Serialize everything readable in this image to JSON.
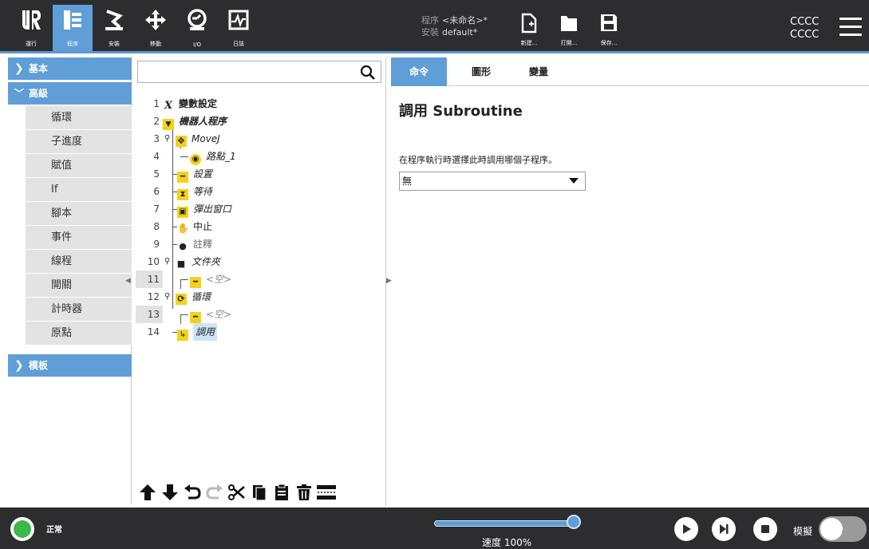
{
  "topnav": {
    "items": [
      {
        "label": "運行",
        "icon": "ur-logo-icon"
      },
      {
        "label": "程序",
        "icon": "program-tree-icon",
        "active": true
      },
      {
        "label": "安裝",
        "icon": "install-icon"
      },
      {
        "label": "移動",
        "icon": "move-arrows-icon"
      },
      {
        "label": "I/O",
        "icon": "io-icon"
      },
      {
        "label": "日誌",
        "icon": "log-icon"
      }
    ],
    "program_key": "程序",
    "program_value": "<未命名>*",
    "install_key": "安裝",
    "install_value": "default*",
    "file_new": "新建...",
    "file_open": "打開...",
    "file_save": "保存...",
    "user_line1": "CCCC",
    "user_line2": "CCCC"
  },
  "left_panel": {
    "cat_basic": "基本",
    "cat_advanced": "高級",
    "advanced_items": [
      "循環",
      "子進度",
      "賦值",
      "If",
      "腳本",
      "事件",
      "線程",
      "開關",
      "計時器",
      "原點"
    ],
    "cat_template": "模板"
  },
  "tree": {
    "search_placeholder": "",
    "rows": [
      {
        "n": "1",
        "label": "變數設定",
        "icon": "x-variable-icon"
      },
      {
        "n": "2",
        "label": "機器人程序",
        "icon": "triangle-down-icon"
      },
      {
        "n": "3",
        "label": "MoveJ",
        "icon": "move-arrows-icon"
      },
      {
        "n": "4",
        "label": "路點_1",
        "icon": "waypoint-icon"
      },
      {
        "n": "5",
        "label": "設置",
        "icon": "set-icon"
      },
      {
        "n": "6",
        "label": "等待",
        "icon": "hourglass-icon"
      },
      {
        "n": "7",
        "label": "彈出窗口",
        "icon": "popup-icon"
      },
      {
        "n": "8",
        "label": "中止",
        "icon": "halt-icon"
      },
      {
        "n": "9",
        "label": "註釋",
        "icon": "comment-icon"
      },
      {
        "n": "10",
        "label": "文件夾",
        "icon": "folder-icon"
      },
      {
        "n": "11",
        "label": "<空>",
        "icon": "empty-node-icon"
      },
      {
        "n": "12",
        "label": "循環",
        "icon": "loop-icon"
      },
      {
        "n": "13",
        "label": "<空>",
        "icon": "empty-node-icon"
      },
      {
        "n": "14",
        "label": "調用",
        "icon": "call-icon"
      }
    ]
  },
  "right_panel": {
    "tabs": [
      "命令",
      "圖形",
      "變量"
    ],
    "active_tab": "命令",
    "title": "調用 Subroutine",
    "description": "在程序執行時選擇此時調用哪個子程序。",
    "dropdown_value": "無"
  },
  "bottom": {
    "status": "正常",
    "speed_label": "速度 100%",
    "speed_percent": 100,
    "simulation_label": "模擬"
  },
  "colors": {
    "accent": "#5f9ed7",
    "bar": "#2d2d2f",
    "status_ok": "#3bb84a"
  }
}
